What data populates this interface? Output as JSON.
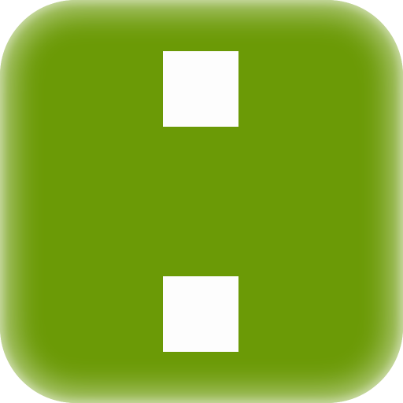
{
  "app_icon": {
    "icon_name": "colon-icon",
    "background_color": "#6b9a06",
    "edge_glow_color": "#ffffff",
    "square_color": "#fdfdfd",
    "square_count": 2
  }
}
